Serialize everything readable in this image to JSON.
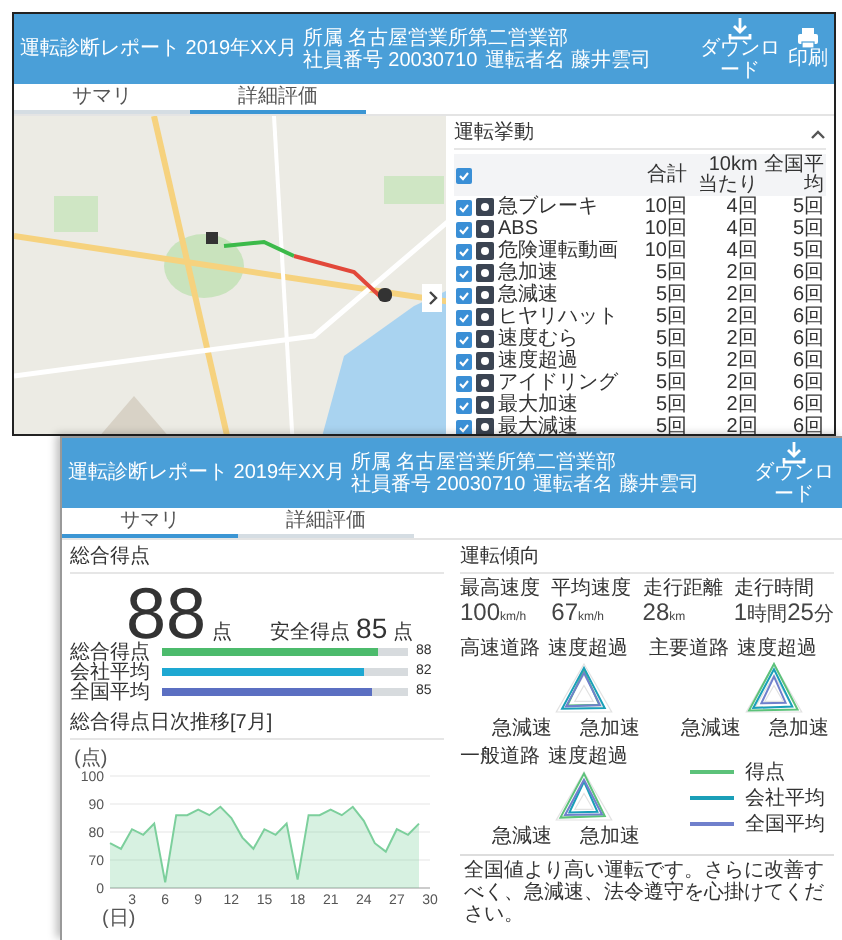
{
  "back_window": {
    "header": {
      "title": "運転診断レポート 2019年XX月",
      "info": [
        "所属 名古屋営業所第二営業部",
        "社員番号 20030710",
        "運転者名 藤井雲司"
      ],
      "actions": [
        {
          "kind": "download",
          "label": "ダウンロード"
        },
        {
          "kind": "print",
          "label": "印刷"
        }
      ]
    },
    "tabs": [
      {
        "label": "サマリ",
        "selected": false
      },
      {
        "label": "詳細評価",
        "selected": true
      }
    ],
    "behavior_panel": {
      "title": "運転挙動",
      "expanded": true,
      "all_checked": true,
      "columns": [
        "合計",
        "10km当たり",
        "全国平均"
      ],
      "rows": [
        {
          "label": "急ブレーキ",
          "checked": true,
          "total": "10回",
          "per_10km": "4回",
          "national": "5回"
        },
        {
          "label": "ABS",
          "checked": true,
          "total": "10回",
          "per_10km": "4回",
          "national": "5回"
        },
        {
          "label": "危険運転動画",
          "checked": true,
          "total": "10回",
          "per_10km": "4回",
          "national": "5回"
        },
        {
          "label": "急加速",
          "checked": true,
          "total": "5回",
          "per_10km": "2回",
          "national": "6回"
        },
        {
          "label": "急減速",
          "checked": true,
          "total": "5回",
          "per_10km": "2回",
          "national": "6回"
        },
        {
          "label": "ヒヤリハット",
          "checked": true,
          "total": "5回",
          "per_10km": "2回",
          "national": "6回"
        },
        {
          "label": "速度むら",
          "checked": true,
          "total": "5回",
          "per_10km": "2回",
          "national": "6回"
        },
        {
          "label": "速度超過",
          "checked": true,
          "total": "5回",
          "per_10km": "2回",
          "national": "6回"
        },
        {
          "label": "アイドリング",
          "checked": true,
          "total": "5回",
          "per_10km": "2回",
          "national": "6回"
        },
        {
          "label": "最大加速",
          "checked": true,
          "total": "5回",
          "per_10km": "2回",
          "national": "6回"
        },
        {
          "label": "最大減速",
          "checked": true,
          "total": "5回",
          "per_10km": "2回",
          "national": "6回"
        }
      ]
    }
  },
  "front_window": {
    "header": {
      "title": "運転診断レポート 2019年XX月",
      "info": [
        "所属 名古屋営業所第二営業部",
        "社員番号 20030710",
        "運転者名 藤井雲司"
      ],
      "actions": [
        {
          "kind": "download",
          "label": "ダウンロード"
        }
      ]
    },
    "tabs": [
      {
        "label": "サマリ",
        "selected": true
      },
      {
        "label": "詳細評価",
        "selected": false
      }
    ],
    "summary": {
      "title": "総合得点",
      "score": "88",
      "score_unit": "点",
      "safety_label": "安全得点",
      "safety_score": "85",
      "safety_unit": "点",
      "bars": [
        {
          "label": "総合得点",
          "level": 0.88,
          "value": "88",
          "color": "#4cbb6c"
        },
        {
          "label": "会社平均",
          "level": 0.82,
          "value": "82",
          "color": "#1ea8d2"
        },
        {
          "label": "全国平均",
          "level": 0.85,
          "value": "85",
          "color": "#5b6fc2"
        }
      ],
      "trend": {
        "title": "総合得点日次推移[7月]",
        "axis_break_label": "0",
        "chart_data": {
          "type": "area",
          "xlabel": "(日)",
          "ylabel": "(点)",
          "x": [
            1,
            2,
            3,
            4,
            5,
            6,
            7,
            8,
            9,
            10,
            11,
            12,
            13,
            14,
            15,
            16,
            17,
            18,
            19,
            20,
            21,
            22,
            23,
            24,
            25,
            26,
            27,
            28,
            29
          ],
          "series": [
            {
              "color": "#7ccf9c",
              "values": [
                76,
                74,
                81,
                79,
                83,
                62,
                86,
                86,
                88,
                86,
                89,
                85,
                78,
                74,
                81,
                79,
                83,
                63,
                86,
                86,
                88,
                86,
                89,
                84,
                76,
                73,
                81,
                79,
                83
              ]
            }
          ],
          "grid": true,
          "xlim": [
            1,
            30
          ],
          "ylim": [
            60,
            100
          ],
          "xticks": [
            3,
            6,
            9,
            12,
            15,
            18,
            21,
            24,
            27,
            30
          ],
          "yticks": [
            70,
            80,
            90,
            100
          ]
        }
      }
    },
    "tendency": {
      "title": "運転傾向",
      "stats": [
        {
          "label": "最高速度",
          "parts": [
            {
              "kind": "number",
              "text": "100"
            },
            {
              "kind": "unit",
              "text": "km/h"
            }
          ]
        },
        {
          "label": "平均速度",
          "parts": [
            {
              "kind": "number",
              "text": "67"
            },
            {
              "kind": "unit",
              "text": "km/h"
            }
          ]
        },
        {
          "label": "走行距離",
          "parts": [
            {
              "kind": "number",
              "text": "28"
            },
            {
              "kind": "unit",
              "text": "km"
            }
          ]
        },
        {
          "label": "走行時間",
          "parts": [
            {
              "kind": "number",
              "text": "1"
            },
            {
              "kind": "unit",
              "text": "時間"
            },
            {
              "kind": "number",
              "text": "25"
            },
            {
              "kind": "unit",
              "text": "分"
            }
          ]
        }
      ],
      "radars": [
        {
          "title": "高速道路",
          "axes": [
            "速度超過",
            "急減速",
            "急加速"
          ]
        },
        {
          "title": "主要道路",
          "axes": [
            "速度超過",
            "急減速",
            "急加速"
          ]
        },
        {
          "title": "一般道路",
          "axes": [
            "速度超過",
            "急減速",
            "急加速"
          ]
        }
      ],
      "legend": [
        {
          "label": "得点",
          "color": "#5cc27a"
        },
        {
          "label": "会社平均",
          "color": "#1a9fb8"
        },
        {
          "label": "全国平均",
          "color": "#7080cc"
        }
      ],
      "comment": "全国値より高い運転です。さらに改善すべく、急減速、法令遵守を心掛けてください。"
    }
  }
}
